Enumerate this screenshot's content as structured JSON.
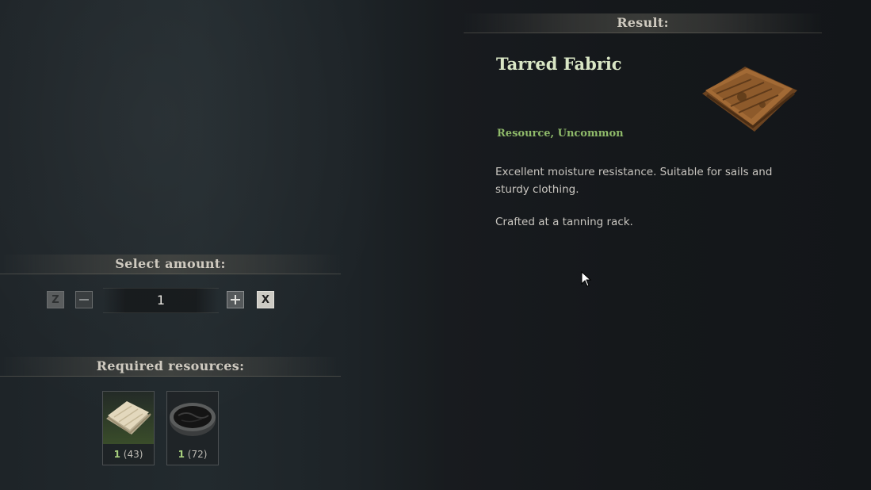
{
  "result": {
    "header": "Result:",
    "title": "Tarred Fabric",
    "rarity": "Resource, Uncommon",
    "description": "Excellent moisture resistance. Suitable for sails and sturdy clothing.",
    "crafted_at": "Crafted at a tanning rack.",
    "icon": "tarred-fabric-icon"
  },
  "amount": {
    "header": "Select amount:",
    "decrease_key": "Z",
    "increase_key": "X",
    "value": "1"
  },
  "resources": {
    "header": "Required resources:",
    "items": [
      {
        "icon": "linen-cloth-icon",
        "required": "1",
        "owned": "(43)"
      },
      {
        "icon": "tar-bowl-icon",
        "required": "1",
        "owned": "(72)"
      }
    ]
  },
  "colors": {
    "title": "#d9e6c5",
    "rarity": "#8fba6a",
    "required_count": "#a8d07e"
  }
}
